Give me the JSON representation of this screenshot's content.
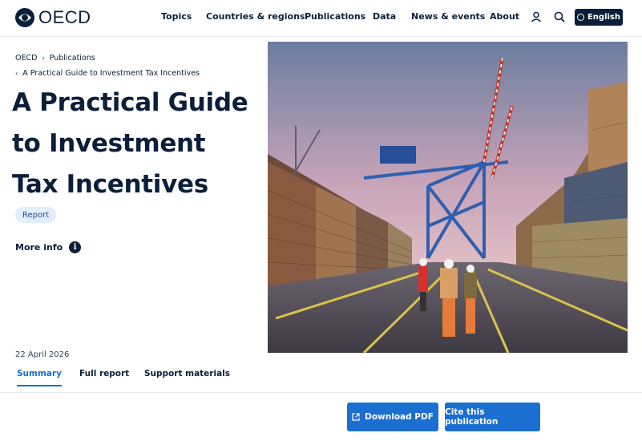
{
  "header": {
    "logo_text": "OECD",
    "nav": [
      "Topics",
      "Countries & regions",
      "Publications",
      "Data",
      "News & events",
      "About"
    ],
    "language_label": "English"
  },
  "breadcrumb": {
    "items": [
      "OECD",
      "Publications"
    ],
    "current": "A Practical Guide to Investment Tax Incentives"
  },
  "publication": {
    "title_lines": [
      "A Practical Guide",
      "to Investment",
      "Tax Incentives"
    ],
    "type_badge": "Report",
    "more_info_label": "More info",
    "date": "22 April 2026"
  },
  "tabs": [
    {
      "label": "Summary",
      "active": true
    },
    {
      "label": "Full report",
      "active": false
    },
    {
      "label": "Support materials",
      "active": false
    }
  ],
  "actions": {
    "download_label": "Download PDF",
    "cite_label": "Cite this publication"
  },
  "colors": {
    "navy": "#0b1f3a",
    "accent_blue": "#1b6fd1",
    "badge_bg": "#e4edf9"
  },
  "icons": {
    "user": "user-icon",
    "search": "search-icon",
    "globe": "globe-icon",
    "info": "info-icon",
    "external": "external-link-icon"
  }
}
